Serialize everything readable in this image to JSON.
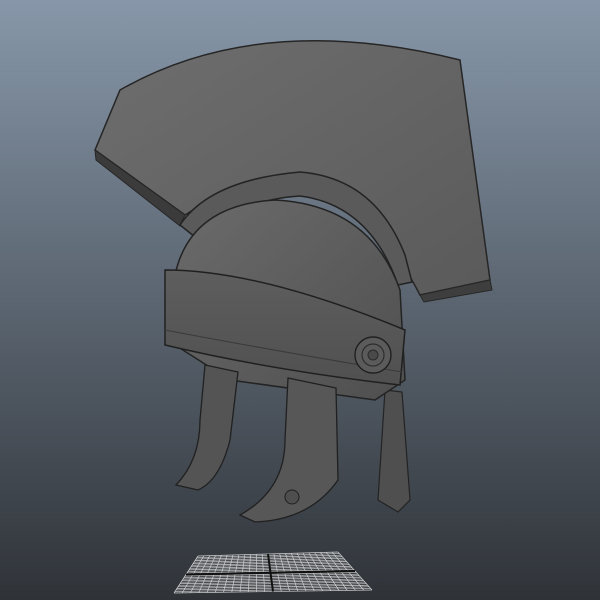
{
  "viewport": {
    "background_top": "#8797a9",
    "background_bottom": "#2f3338"
  },
  "model": {
    "name": "roman-galea-helmet",
    "shade_light": "#707070",
    "shade_mid": "#5c5c5c",
    "shade_dark": "#3f3f3f",
    "outline": "#222222"
  },
  "ground_grid": {
    "color": "#cfcfcf",
    "axis_color": "#111111"
  }
}
